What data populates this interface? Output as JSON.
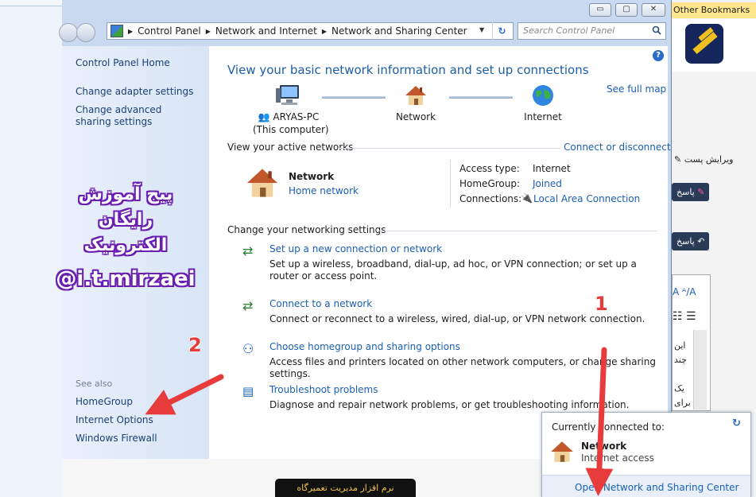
{
  "browser": {
    "bookmark_label": "Other Bookmarks"
  },
  "window": {
    "title_buttons": [
      "▭",
      "▢",
      "✕"
    ],
    "breadcrumb": [
      "Control Panel",
      "Network and Internet",
      "Network and Sharing Center"
    ],
    "search_placeholder": "Search Control Panel"
  },
  "sidebar": {
    "home": "Control Panel Home",
    "items": [
      {
        "label": "Change adapter settings"
      },
      {
        "label": "Change advanced sharing settings"
      }
    ],
    "see_also_title": "See also",
    "see_also": [
      {
        "label": "HomeGroup"
      },
      {
        "label": "Internet Options"
      },
      {
        "label": "Windows Firewall"
      }
    ]
  },
  "main": {
    "title": "View your basic network information and set up connections",
    "see_full_map": "See full map",
    "map": {
      "computer_name": "ARYAS-PC",
      "computer_note": "(This computer)",
      "network": "Network",
      "internet": "Internet"
    },
    "active_networks": {
      "heading": "View your active networks",
      "connect_link": "Connect or disconnect",
      "network_name": "Network",
      "network_type": "Home network",
      "access_type_label": "Access type:",
      "access_type_value": "Internet",
      "homegroup_label": "HomeGroup:",
      "homegroup_value": "Joined",
      "connections_label": "Connections:",
      "connections_value": "Local Area Connection"
    },
    "settings": {
      "heading": "Change your networking settings",
      "tasks": [
        {
          "title": "Set up a new connection or network",
          "desc": "Set up a wireless, broadband, dial-up, ad hoc, or VPN connection; or set up a router or access point."
        },
        {
          "title": "Connect to a network",
          "desc": "Connect or reconnect to a wireless, wired, dial-up, or VPN network connection."
        },
        {
          "title": "Choose homegroup and sharing options",
          "desc": "Access files and printers located on other network computers, or change sharing settings."
        },
        {
          "title": "Troubleshoot problems",
          "desc": "Diagnose and repair network problems, or get troubleshooting information."
        }
      ]
    }
  },
  "popup": {
    "heading": "Currently connected to:",
    "network_name": "Network",
    "status": "Internet access",
    "footer_link": "Open Network and Sharing Center"
  },
  "right_panel": {
    "edit_post": "ویرایش پست",
    "reply1": "پاسخ",
    "reply2": "پاسخ",
    "line1": "این",
    "line2": "چند",
    "line3": "یک",
    "line4": "برای"
  },
  "bottom": {
    "button_label": "نرم افزار مدیریت تعمیرگاه"
  },
  "watermark": {
    "line1": "پیج آموزش",
    "line2": "رایگان",
    "line3": "الکترونیک",
    "line4": "@i.t.mirzaei"
  },
  "annotations": {
    "n1": "1",
    "n2": "2",
    "color": "#e83b3b"
  }
}
